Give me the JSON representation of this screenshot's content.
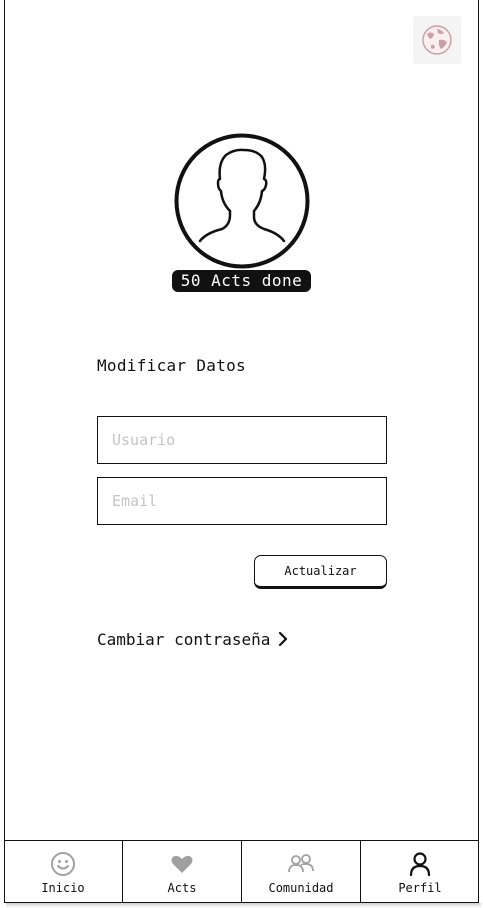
{
  "header": {
    "language_icon": "globe-icon"
  },
  "profile": {
    "avatar_icon": "user-silhouette-icon",
    "badge": "50 Acts done"
  },
  "form": {
    "title": "Modificar Datos",
    "username_placeholder": "Usuario",
    "email_placeholder": "Email",
    "username_value": "",
    "email_value": "",
    "submit_label": "Actualizar"
  },
  "change_password": {
    "label": "Cambiar contraseña",
    "icon": "chevron-right-icon"
  },
  "tabbar": {
    "tabs": [
      {
        "label": "Inicio",
        "icon": "smiley-icon",
        "active": false
      },
      {
        "label": "Acts",
        "icon": "heart-icon",
        "active": false
      },
      {
        "label": "Comunidad",
        "icon": "community-icon",
        "active": false
      },
      {
        "label": "Perfil",
        "icon": "person-icon",
        "active": true
      }
    ]
  },
  "colors": {
    "ink": "#111111",
    "muted_icon": "#a0a0a0",
    "placeholder": "#c4c4c4",
    "globe_accent": "#c9a0a8"
  }
}
